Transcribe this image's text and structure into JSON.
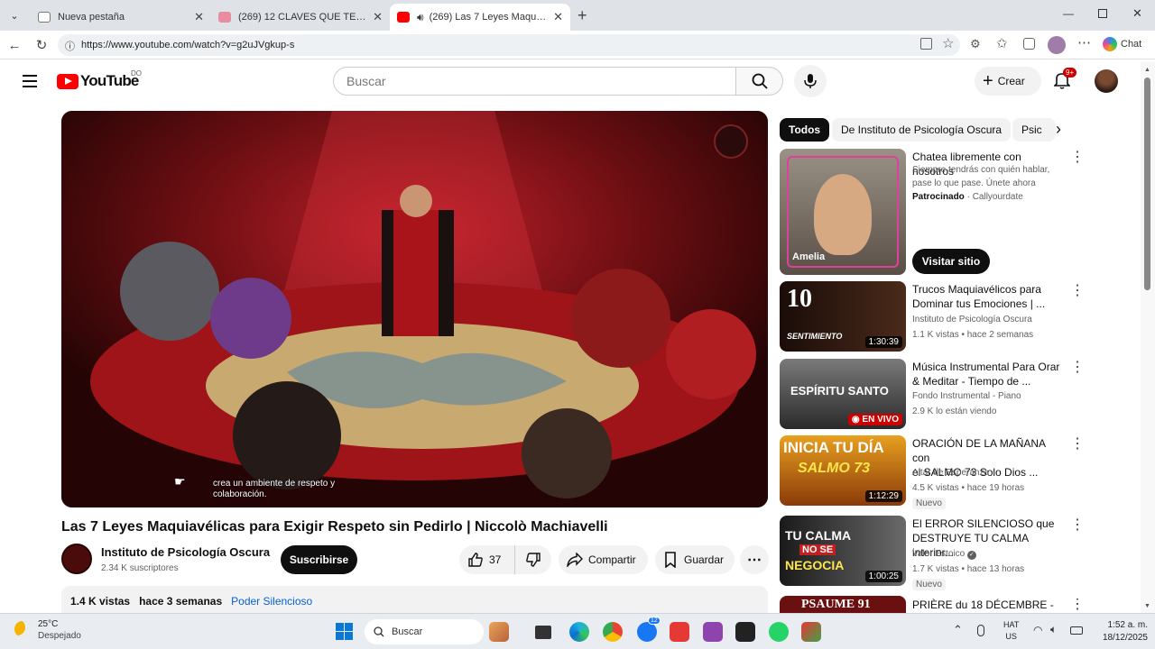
{
  "browser": {
    "tabs": [
      {
        "title": "Nueva pestaña"
      },
      {
        "title": "(269) 12 CLAVES QUE TE HARÁN S"
      },
      {
        "title": "(269) Las 7 Leyes Maquiavélic"
      }
    ],
    "url": "https://www.youtube.com/watch?v=g2uJVgkup-s",
    "chat_label": "Chat"
  },
  "youtube": {
    "logo_text": "YouTube",
    "country": "DO",
    "search_placeholder": "Buscar",
    "create_label": "Crear",
    "notif_badge": "9+"
  },
  "video": {
    "caption_line1": "crea un ambiente de respeto y",
    "caption_line2": "colaboración.",
    "title": "Las 7 Leyes Maquiavélicas para Exigir Respeto sin Pedirlo | Niccolò Machiavelli",
    "channel": "Instituto de Psicología Oscura",
    "subscribers": "2.34 K suscriptores",
    "subscribe_label": "Suscribirse",
    "likes": "37",
    "share_label": "Compartir",
    "save_label": "Guardar",
    "views": "1.4 K vistas",
    "age": "hace 3 semanas",
    "tag": "Poder Silencioso"
  },
  "sidebar": {
    "chips": [
      "Todos",
      "De Instituto de Psicología Oscura",
      "Psic"
    ],
    "ad": {
      "title": "Chatea libremente con nosotros",
      "desc1": "Siempre tendrás con quién hablar,",
      "desc2": "pase lo que pase. Únete ahora",
      "sponsored": "Patrocinado",
      "advertiser": "Callyourdate",
      "thumb_name": "Amelia",
      "cta": "Visitar sitio"
    },
    "items": [
      {
        "title1": "Trucos Maquiavélicos para",
        "title2": "Dominar tus Emociones | ...",
        "channel": "Instituto de Psicología Oscura",
        "meta": "1.1 K vistas • hace 2 semanas",
        "duration": "1:30:39",
        "thumb_text": "10",
        "thumb_sub": "SENTIMIENTO"
      },
      {
        "title1": "Música Instrumental Para Orar",
        "title2": "& Meditar - Tiempo de ...",
        "channel": "Fondo Instrumental - Piano",
        "meta": "2.9 K lo están viendo",
        "live": "EN VIVO",
        "thumb_text": "ESPÍRITU SANTO"
      },
      {
        "title1": "ORACIÓN DE LA MAÑANA con",
        "title2": "el SALMO 73  Solo Dios ...",
        "channel": "Altar de Esperanza",
        "meta": "4.5 K vistas • hace 19 horas",
        "duration": "1:12:29",
        "badge": "Nuevo",
        "thumb_text": "INICIA TU DÍA",
        "thumb_sub": "SALMO 73"
      },
      {
        "title1": "El ERROR SILENCIOSO que",
        "title2": "DESTRUYE TU CALMA interior...",
        "channel": "Valor Estoico",
        "meta": "1.7 K vistas • hace 13 horas",
        "duration": "1:00:25",
        "badge": "Nuevo",
        "thumb_text": "TU CALMA",
        "thumb_sub": "NO SE",
        "thumb_sub2": "NEGOCIA"
      },
      {
        "title1": "PRIÈRE du 18 DÉCEMBRE -",
        "thumb_text": "PSAUME 91"
      }
    ]
  },
  "taskbar": {
    "weather_temp": "25°C",
    "weather_desc": "Despejado",
    "search_label": "Buscar",
    "lang1": "HAT",
    "lang2": "US",
    "time": "1:52 a. m.",
    "date": "18/12/2025",
    "badge": "12"
  }
}
